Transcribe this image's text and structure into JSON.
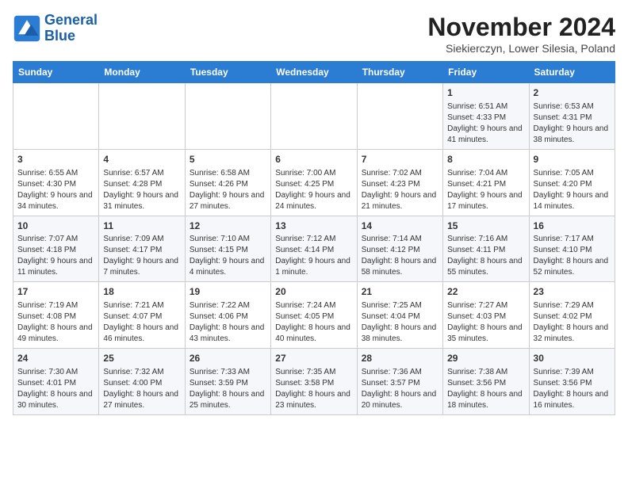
{
  "logo": {
    "line1": "General",
    "line2": "Blue"
  },
  "title": "November 2024",
  "subtitle": "Siekierczyn, Lower Silesia, Poland",
  "weekdays": [
    "Sunday",
    "Monday",
    "Tuesday",
    "Wednesday",
    "Thursday",
    "Friday",
    "Saturday"
  ],
  "weeks": [
    [
      {
        "day": "",
        "info": ""
      },
      {
        "day": "",
        "info": ""
      },
      {
        "day": "",
        "info": ""
      },
      {
        "day": "",
        "info": ""
      },
      {
        "day": "",
        "info": ""
      },
      {
        "day": "1",
        "info": "Sunrise: 6:51 AM\nSunset: 4:33 PM\nDaylight: 9 hours and 41 minutes."
      },
      {
        "day": "2",
        "info": "Sunrise: 6:53 AM\nSunset: 4:31 PM\nDaylight: 9 hours and 38 minutes."
      }
    ],
    [
      {
        "day": "3",
        "info": "Sunrise: 6:55 AM\nSunset: 4:30 PM\nDaylight: 9 hours and 34 minutes."
      },
      {
        "day": "4",
        "info": "Sunrise: 6:57 AM\nSunset: 4:28 PM\nDaylight: 9 hours and 31 minutes."
      },
      {
        "day": "5",
        "info": "Sunrise: 6:58 AM\nSunset: 4:26 PM\nDaylight: 9 hours and 27 minutes."
      },
      {
        "day": "6",
        "info": "Sunrise: 7:00 AM\nSunset: 4:25 PM\nDaylight: 9 hours and 24 minutes."
      },
      {
        "day": "7",
        "info": "Sunrise: 7:02 AM\nSunset: 4:23 PM\nDaylight: 9 hours and 21 minutes."
      },
      {
        "day": "8",
        "info": "Sunrise: 7:04 AM\nSunset: 4:21 PM\nDaylight: 9 hours and 17 minutes."
      },
      {
        "day": "9",
        "info": "Sunrise: 7:05 AM\nSunset: 4:20 PM\nDaylight: 9 hours and 14 minutes."
      }
    ],
    [
      {
        "day": "10",
        "info": "Sunrise: 7:07 AM\nSunset: 4:18 PM\nDaylight: 9 hours and 11 minutes."
      },
      {
        "day": "11",
        "info": "Sunrise: 7:09 AM\nSunset: 4:17 PM\nDaylight: 9 hours and 7 minutes."
      },
      {
        "day": "12",
        "info": "Sunrise: 7:10 AM\nSunset: 4:15 PM\nDaylight: 9 hours and 4 minutes."
      },
      {
        "day": "13",
        "info": "Sunrise: 7:12 AM\nSunset: 4:14 PM\nDaylight: 9 hours and 1 minute."
      },
      {
        "day": "14",
        "info": "Sunrise: 7:14 AM\nSunset: 4:12 PM\nDaylight: 8 hours and 58 minutes."
      },
      {
        "day": "15",
        "info": "Sunrise: 7:16 AM\nSunset: 4:11 PM\nDaylight: 8 hours and 55 minutes."
      },
      {
        "day": "16",
        "info": "Sunrise: 7:17 AM\nSunset: 4:10 PM\nDaylight: 8 hours and 52 minutes."
      }
    ],
    [
      {
        "day": "17",
        "info": "Sunrise: 7:19 AM\nSunset: 4:08 PM\nDaylight: 8 hours and 49 minutes."
      },
      {
        "day": "18",
        "info": "Sunrise: 7:21 AM\nSunset: 4:07 PM\nDaylight: 8 hours and 46 minutes."
      },
      {
        "day": "19",
        "info": "Sunrise: 7:22 AM\nSunset: 4:06 PM\nDaylight: 8 hours and 43 minutes."
      },
      {
        "day": "20",
        "info": "Sunrise: 7:24 AM\nSunset: 4:05 PM\nDaylight: 8 hours and 40 minutes."
      },
      {
        "day": "21",
        "info": "Sunrise: 7:25 AM\nSunset: 4:04 PM\nDaylight: 8 hours and 38 minutes."
      },
      {
        "day": "22",
        "info": "Sunrise: 7:27 AM\nSunset: 4:03 PM\nDaylight: 8 hours and 35 minutes."
      },
      {
        "day": "23",
        "info": "Sunrise: 7:29 AM\nSunset: 4:02 PM\nDaylight: 8 hours and 32 minutes."
      }
    ],
    [
      {
        "day": "24",
        "info": "Sunrise: 7:30 AM\nSunset: 4:01 PM\nDaylight: 8 hours and 30 minutes."
      },
      {
        "day": "25",
        "info": "Sunrise: 7:32 AM\nSunset: 4:00 PM\nDaylight: 8 hours and 27 minutes."
      },
      {
        "day": "26",
        "info": "Sunrise: 7:33 AM\nSunset: 3:59 PM\nDaylight: 8 hours and 25 minutes."
      },
      {
        "day": "27",
        "info": "Sunrise: 7:35 AM\nSunset: 3:58 PM\nDaylight: 8 hours and 23 minutes."
      },
      {
        "day": "28",
        "info": "Sunrise: 7:36 AM\nSunset: 3:57 PM\nDaylight: 8 hours and 20 minutes."
      },
      {
        "day": "29",
        "info": "Sunrise: 7:38 AM\nSunset: 3:56 PM\nDaylight: 8 hours and 18 minutes."
      },
      {
        "day": "30",
        "info": "Sunrise: 7:39 AM\nSunset: 3:56 PM\nDaylight: 8 hours and 16 minutes."
      }
    ]
  ]
}
